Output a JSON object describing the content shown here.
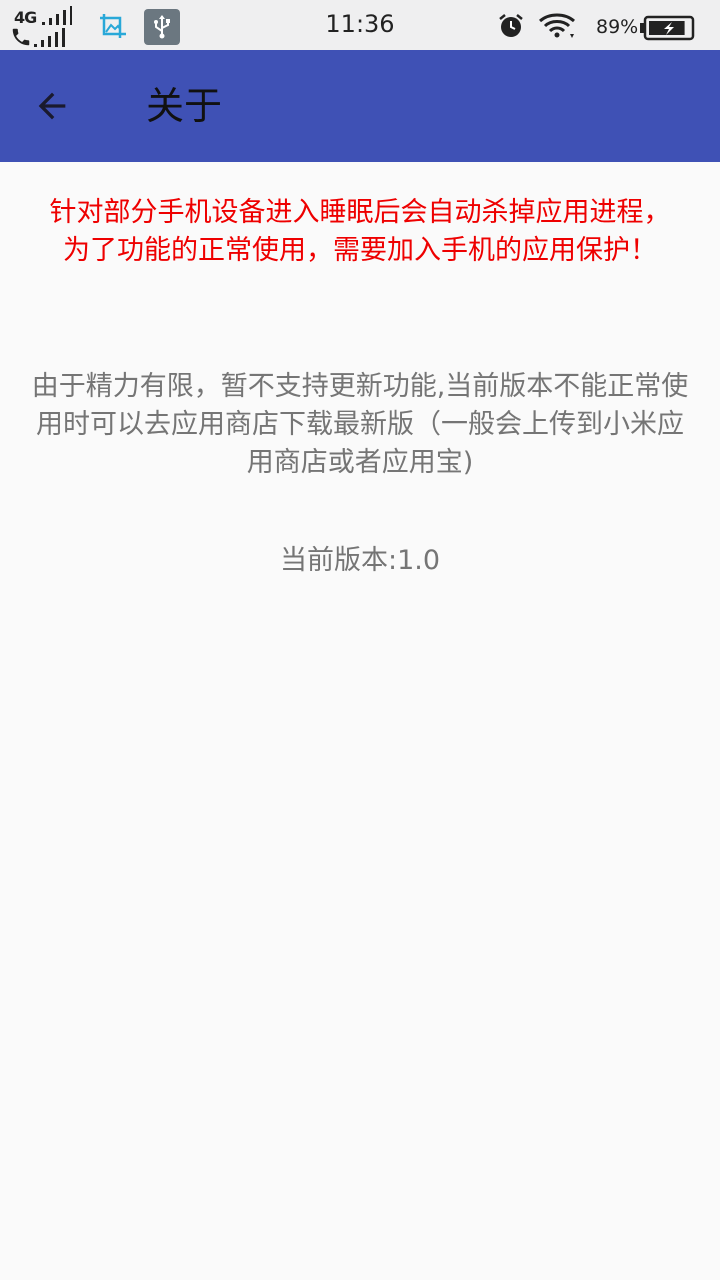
{
  "status_bar": {
    "network_type": "4G",
    "time": "11:36",
    "battery_percent": "89%",
    "battery_level": 0.89,
    "icons": [
      "signal-icon",
      "phone-signal-icon",
      "gallery-icon",
      "usb-icon",
      "alarm-icon",
      "wifi-icon",
      "battery-charging-icon"
    ],
    "usb_icon_bg": "#6b7780",
    "gallery_icon_color": "#29a8d8"
  },
  "app_bar": {
    "title": "关于",
    "back_icon": "arrow-left-icon",
    "background_color": "#3f51b5"
  },
  "content": {
    "warning": "针对部分手机设备进入睡眠后会自动杀掉应用进程，为了功能的正常使用，需要加入手机的应用保护！",
    "warning_color": "#ee0000",
    "info": "由于精力有限，暂不支持更新功能,当前版本不能正常使用时可以去应用商店下载最新版（一般会上传到小米应用商店或者应用宝)",
    "version": "当前版本:1.0",
    "text_color": "#757575"
  }
}
